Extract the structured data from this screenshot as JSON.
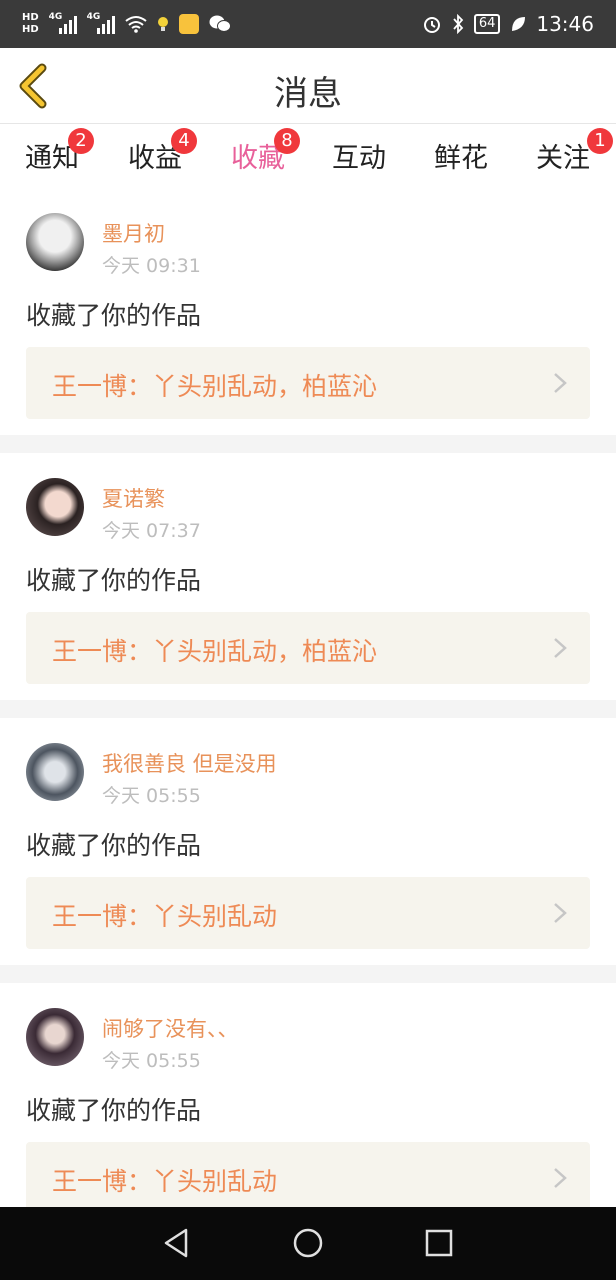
{
  "status": {
    "hd1": "HD",
    "hd2": "HD",
    "net1": "4G",
    "net2": "4G",
    "battery": "64",
    "time": "13:46"
  },
  "header": {
    "title": "消息"
  },
  "tabs": [
    {
      "label": "通知",
      "badge": "2"
    },
    {
      "label": "收益",
      "badge": "4"
    },
    {
      "label": "收藏",
      "badge": "8"
    },
    {
      "label": "互动",
      "badge": ""
    },
    {
      "label": "鲜花",
      "badge": ""
    },
    {
      "label": "关注",
      "badge": "1"
    }
  ],
  "active_tab": "收藏",
  "feed": [
    {
      "name": "墨月初",
      "time": "今天 09:31",
      "action": "收藏了你的作品",
      "work": "王一博：丫头别乱动，柏蓝沁"
    },
    {
      "name": "夏诺繁",
      "time": "今天 07:37",
      "action": "收藏了你的作品",
      "work": "王一博：丫头别乱动，柏蓝沁"
    },
    {
      "name": "我很善良 但是没用",
      "time": "今天 05:55",
      "action": "收藏了你的作品",
      "work": "王一博：丫头别乱动"
    },
    {
      "name": "闹够了没有、、",
      "time": "今天 05:55",
      "action": "收藏了你的作品",
      "work": "王一博：丫头别乱动"
    }
  ],
  "colors": {
    "accent": "#e8609a",
    "username": "#e8925a",
    "work_title": "#ee8a55",
    "badge": "#f0383c",
    "work_bg": "#f6f4ed"
  }
}
